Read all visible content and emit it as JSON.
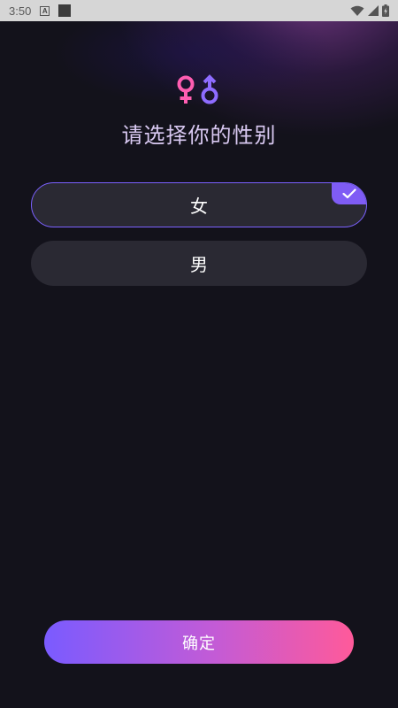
{
  "status_bar": {
    "time": "3:50",
    "notification_icon_letter": "A"
  },
  "header": {
    "title": "请选择你的性别"
  },
  "options": [
    {
      "label": "女",
      "selected": true
    },
    {
      "label": "男",
      "selected": false
    }
  ],
  "confirm": {
    "label": "确定"
  },
  "colors": {
    "background": "#13121b",
    "option_bg": "#2a2933",
    "accent": "#7b61ff",
    "female_symbol": "#ff5db1",
    "male_symbol": "#8e6cff",
    "title_text": "#d9c9f2",
    "gradient_start": "#7a5bff",
    "gradient_end": "#ff5a9a"
  },
  "icons": {
    "logo": "female-male-symbols-icon",
    "selected": "check-icon"
  }
}
